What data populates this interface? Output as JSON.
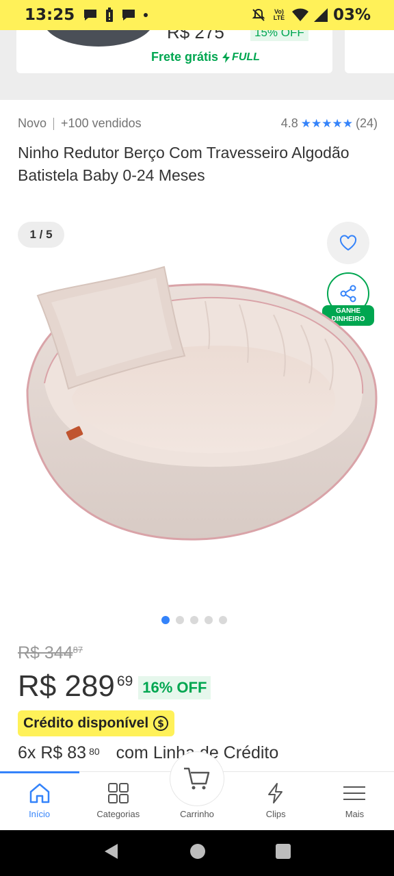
{
  "status_bar": {
    "time": "13:25",
    "battery": "03%",
    "volte": "Vo)) LTE"
  },
  "previous_card": {
    "price_cut": "R$ 275",
    "off_cut": "15% OFF",
    "shipping": "Frete grátis",
    "full": "FULL"
  },
  "product": {
    "condition": "Novo",
    "sold": "+100 vendidos",
    "rating": "4.8",
    "stars": "★★★★★",
    "reviews": "(24)",
    "title": "Ninho Redutor Berço Com Travesseiro Algodão Batistela Baby 0-24 Meses"
  },
  "gallery": {
    "counter": "1 / 5",
    "total_images": 5,
    "active_index": 0,
    "earn_badge_line1": "GANHE",
    "earn_badge_line2": "DINHEIRO",
    "colors": {
      "active_dot": "#3483fa",
      "inactive_dot": "#d9d9d9"
    }
  },
  "pricing": {
    "old_price_main": "R$ 344",
    "old_price_cents": "87",
    "price_main": "R$ 289",
    "price_cents": "69",
    "discount": "16% OFF",
    "credit_badge": "Crédito disponível",
    "installments_prefix": "6x R$ 83",
    "installments_cents": "80",
    "installments_suffix": "com Linha de Crédito"
  },
  "bottom_nav": {
    "items": [
      {
        "label": "Início",
        "icon": "home-icon",
        "active": true
      },
      {
        "label": "Categorias",
        "icon": "grid-icon",
        "active": false
      },
      {
        "label": "Carrinho",
        "icon": "cart-icon",
        "active": false
      },
      {
        "label": "Clips",
        "icon": "lightning-icon",
        "active": false
      },
      {
        "label": "Mais",
        "icon": "menu-icon",
        "active": false
      }
    ]
  },
  "colors": {
    "brand_yellow": "#fff159",
    "accent_blue": "#3483fa",
    "success_green": "#00a650"
  }
}
